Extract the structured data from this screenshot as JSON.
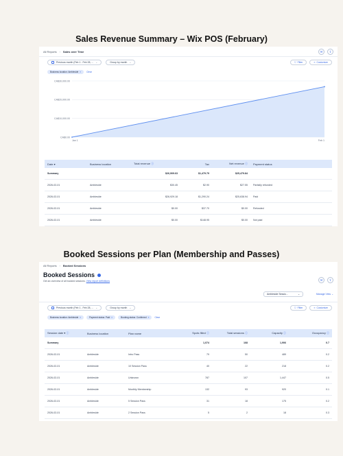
{
  "section1": {
    "title": "Sales Revenue Summary – Wix POS (February)",
    "breadcrumb": [
      "All Reports",
      "Sales over Time"
    ],
    "date_filter": "Previous month (Feb 1 - Feb 28, ...",
    "group_by": "Group by month",
    "filter_label": "Filter",
    "customize_label": "Customize",
    "chips": [
      "Business location: Ambleside"
    ],
    "clear_label": "Clear",
    "chart_data": {
      "type": "area",
      "x": [
        "Jan 1",
        "Feb 1"
      ],
      "values": [
        0,
        26909.63
      ],
      "y_ticks": [
        "CA$0.00",
        "CA$10,000.00",
        "CA$20,000.00",
        "CA$30,000.00"
      ],
      "ylim": [
        0,
        30000
      ],
      "xlabel": "",
      "ylabel": "",
      "color": "#5b8def",
      "fill": "#dbe7fb"
    },
    "table": {
      "headers": [
        "Date",
        "Business location",
        "Total revenue",
        "Tax",
        "Net revenue",
        "Payment status"
      ],
      "summary": [
        "Summary",
        "",
        "$26,909.63",
        "$1,479.79",
        "$25,479.84",
        ""
      ],
      "rows": [
        [
          "2026-02-01",
          "Ambleside",
          "$30.45",
          "$2.90",
          "$27.55",
          "Partially refunded"
        ],
        [
          "2026-02-01",
          "Ambleside",
          "$26,929.18",
          "$1,290.24",
          "$25,638.94",
          "Paid"
        ],
        [
          "2026-02-01",
          "Ambleside",
          "$0.00",
          "$37.70",
          "$0.00",
          "Refunded"
        ],
        [
          "2026-02-01",
          "Ambleside",
          "$0.00",
          "$148.95",
          "$0.00",
          "Not paid"
        ]
      ]
    }
  },
  "section2": {
    "title": "Booked Sessions per Plan (Membership and Passes)",
    "breadcrumb": [
      "All Reports",
      "Booked Sessions"
    ],
    "page_title": "Booked Sessions",
    "subtitle": "Get an overview of all booked sessions.",
    "subtitle_link": "View report definitions",
    "view_select": "Ambleside Sessio...",
    "manage_view": "Manage View",
    "date_filter": "Previous month (Feb 1 - Feb 28, ...",
    "group_by": "Group by month",
    "filter_label": "Filter",
    "customize_label": "Customize",
    "chips": [
      "Business location: Ambleside",
      "Payment status: Paid",
      "Booking status: Confirmed"
    ],
    "clear_label": "Clear",
    "table": {
      "headers": [
        "Session date",
        "Business location",
        "Plan name",
        "Spots filled",
        "Total sessions",
        "Capacity",
        "Occupancy"
      ],
      "summary": [
        "Summary",
        "",
        "",
        "1,074",
        "168",
        "1,906",
        "0.7"
      ],
      "rows": [
        [
          "2026-02-01",
          "Ambleside",
          "Intro Pass",
          "79",
          "50",
          "489",
          "0.2"
        ],
        [
          "2026-02-01",
          "Ambleside",
          "10 Session Pass",
          "40",
          "22",
          "218",
          "0.2"
        ],
        [
          "2026-02-01",
          "Ambleside",
          "Unknown",
          "787",
          "107",
          "1,447",
          "0.5"
        ],
        [
          "2026-02-01",
          "Ambleside",
          "Monthly Membership",
          "132",
          "93",
          "920",
          "0.1"
        ],
        [
          "2026-02-01",
          "Ambleside",
          "5 Session Pass",
          "31",
          "18",
          "175",
          "0.2"
        ],
        [
          "2026-02-01",
          "Ambleside",
          "2 Session Pass",
          "5",
          "2",
          "18",
          "0.3"
        ]
      ]
    }
  }
}
